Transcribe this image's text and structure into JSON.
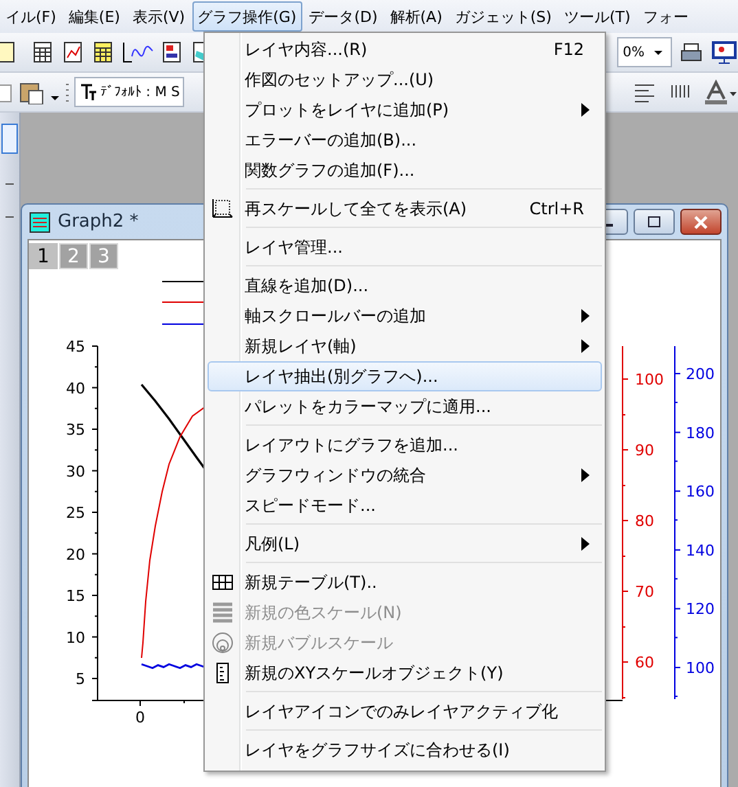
{
  "menubar": [
    {
      "label": "イル(F)",
      "selected": false
    },
    {
      "label": "編集(E)",
      "selected": false
    },
    {
      "label": "表示(V)",
      "selected": false
    },
    {
      "label": "グラフ操作(G)",
      "selected": true
    },
    {
      "label": "データ(D)",
      "selected": false
    },
    {
      "label": "解析(A)",
      "selected": false
    },
    {
      "label": "ガジェット(S)",
      "selected": false
    },
    {
      "label": "ツール(T)",
      "selected": false
    },
    {
      "label": "フォー",
      "selected": false
    }
  ],
  "toolbar": {
    "zoom": "0%",
    "font": "ﾃﾞﾌｫﾙﾄ : M S"
  },
  "graph_window": {
    "title": "Graph2 *",
    "layers": [
      {
        "label": "1",
        "selected": true
      },
      {
        "label": "2",
        "selected": false
      },
      {
        "label": "3",
        "selected": false
      }
    ],
    "plot": {
      "left_axis": [
        "45",
        "40",
        "35",
        "30",
        "25",
        "20",
        "15",
        "10",
        "5"
      ],
      "bottom_axis": [
        "0"
      ],
      "red_axis": [
        "100",
        "90",
        "80",
        "70",
        "60"
      ],
      "blue_axis": [
        "200",
        "180",
        "160",
        "140",
        "120",
        "100"
      ]
    }
  },
  "menu": [
    {
      "kind": "item",
      "label": "レイヤ内容...(R)",
      "shortcut": "F12",
      "submenu": false,
      "disabled": false,
      "selected": false
    },
    {
      "kind": "item",
      "label": "作図のセットアップ...(U)",
      "submenu": false,
      "disabled": false,
      "selected": false
    },
    {
      "kind": "item",
      "label": "プロットをレイヤに追加(P)",
      "submenu": true,
      "disabled": false,
      "selected": false
    },
    {
      "kind": "item",
      "label": "エラーバーの追加(B)...",
      "submenu": false,
      "disabled": false,
      "selected": false
    },
    {
      "kind": "item",
      "label": "関数グラフの追加(F)...",
      "submenu": false,
      "disabled": false,
      "selected": false
    },
    {
      "kind": "separator"
    },
    {
      "kind": "item",
      "label": "再スケールして全てを表示(A)",
      "shortcut": "Ctrl+R",
      "submenu": false,
      "disabled": false,
      "selected": false
    },
    {
      "kind": "separator"
    },
    {
      "kind": "item",
      "label": "レイヤ管理...",
      "submenu": false,
      "disabled": false,
      "selected": false
    },
    {
      "kind": "separator"
    },
    {
      "kind": "item",
      "label": "直線を追加(D)...",
      "submenu": false,
      "disabled": false,
      "selected": false
    },
    {
      "kind": "item",
      "label": "軸スクロールバーの追加",
      "submenu": true,
      "disabled": false,
      "selected": false
    },
    {
      "kind": "item",
      "label": "新規レイヤ(軸)",
      "submenu": true,
      "disabled": false,
      "selected": false
    },
    {
      "kind": "item",
      "label": "レイヤ抽出(別グラフへ)...",
      "submenu": false,
      "disabled": false,
      "selected": true
    },
    {
      "kind": "item",
      "label": "パレットをカラーマップに適用...",
      "submenu": false,
      "disabled": false,
      "selected": false
    },
    {
      "kind": "separator"
    },
    {
      "kind": "item",
      "label": "レイアウトにグラフを追加...",
      "submenu": false,
      "disabled": false,
      "selected": false
    },
    {
      "kind": "item",
      "label": "グラフウィンドウの統合",
      "submenu": true,
      "disabled": false,
      "selected": false
    },
    {
      "kind": "item",
      "label": "スピードモード...",
      "submenu": false,
      "disabled": false,
      "selected": false
    },
    {
      "kind": "separator"
    },
    {
      "kind": "item",
      "label": "凡例(L)",
      "submenu": true,
      "disabled": false,
      "selected": false
    },
    {
      "kind": "separator"
    },
    {
      "kind": "item",
      "label": "新規テーブル(T)..",
      "submenu": false,
      "disabled": false,
      "selected": false
    },
    {
      "kind": "item",
      "label": "新規の色スケール(N)",
      "submenu": false,
      "disabled": true,
      "selected": false
    },
    {
      "kind": "item",
      "label": "新規バブルスケール",
      "submenu": false,
      "disabled": true,
      "selected": false
    },
    {
      "kind": "item",
      "label": "新規のXYスケールオブジェクト(Y)",
      "submenu": false,
      "disabled": false,
      "selected": false
    },
    {
      "kind": "separator"
    },
    {
      "kind": "item",
      "label": "レイヤアイコンでのみレイヤアクティブ化",
      "submenu": false,
      "disabled": false,
      "selected": false
    },
    {
      "kind": "separator"
    },
    {
      "kind": "item",
      "label": "レイヤをグラフサイズに合わせる(I)",
      "submenu": false,
      "disabled": false,
      "selected": false
    }
  ]
}
